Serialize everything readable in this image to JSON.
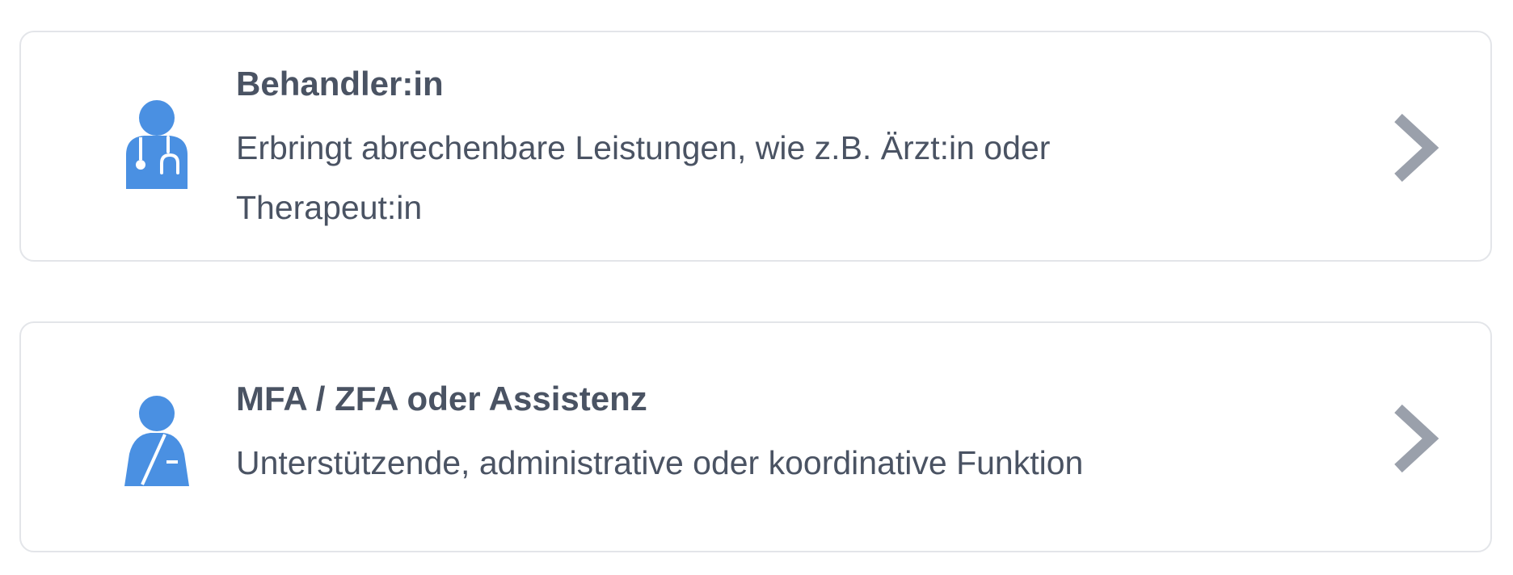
{
  "colors": {
    "icon_blue": "#4a90e2",
    "text": "#4a5363",
    "chevron_gray": "#9aa0ab",
    "border": "#e3e5e9"
  },
  "options": [
    {
      "icon": "doctor-stethoscope-icon",
      "title": "Behandler:in",
      "description": "Erbringt abrechenbare Leistungen, wie z.B. Ärzt:in oder Therapeut:in",
      "chevron_icon": "chevron-right-icon"
    },
    {
      "icon": "assistant-person-icon",
      "title": "MFA / ZFA oder Assistenz",
      "description": "Unterstützende, administrative oder koordinative Funktion",
      "chevron_icon": "chevron-right-icon"
    }
  ]
}
